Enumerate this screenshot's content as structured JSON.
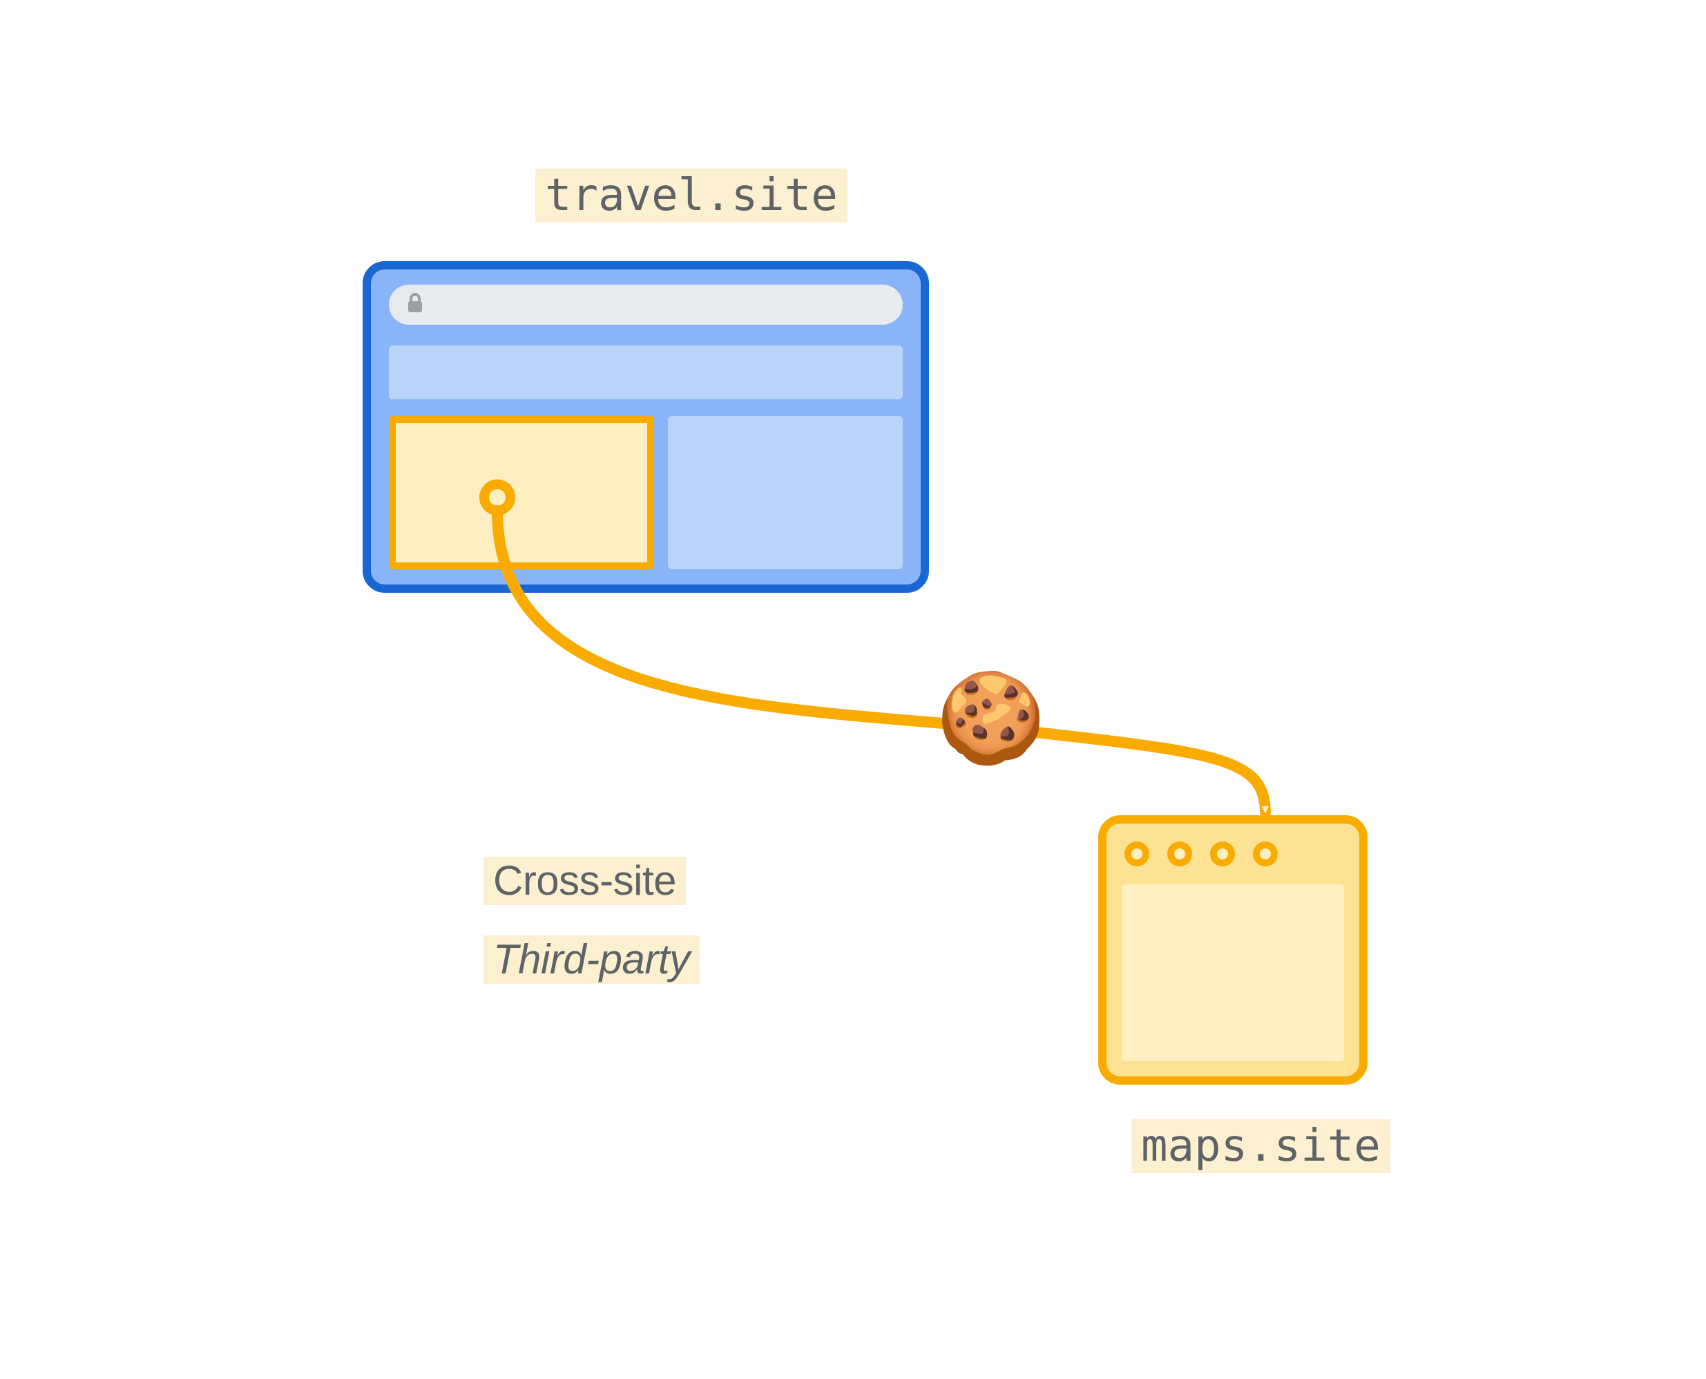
{
  "labels": {
    "first_party": "travel.site",
    "third_party": "maps.site",
    "cross_site": "Cross-site",
    "third_party_text": "Third-party"
  },
  "icons": {
    "lock": "lock-icon",
    "cookie": "🍪"
  },
  "colors": {
    "blue_border": "#1967d2",
    "blue_fill": "#8ab4f8",
    "blue_light": "#bad3f8",
    "urlbar_gray": "#e8eaed",
    "orange_border": "#f9ab00",
    "orange_fill": "#fde293",
    "orange_light": "#feefc3",
    "highlight_bg": "#fdf0d0",
    "text_gray": "#5f6368"
  }
}
